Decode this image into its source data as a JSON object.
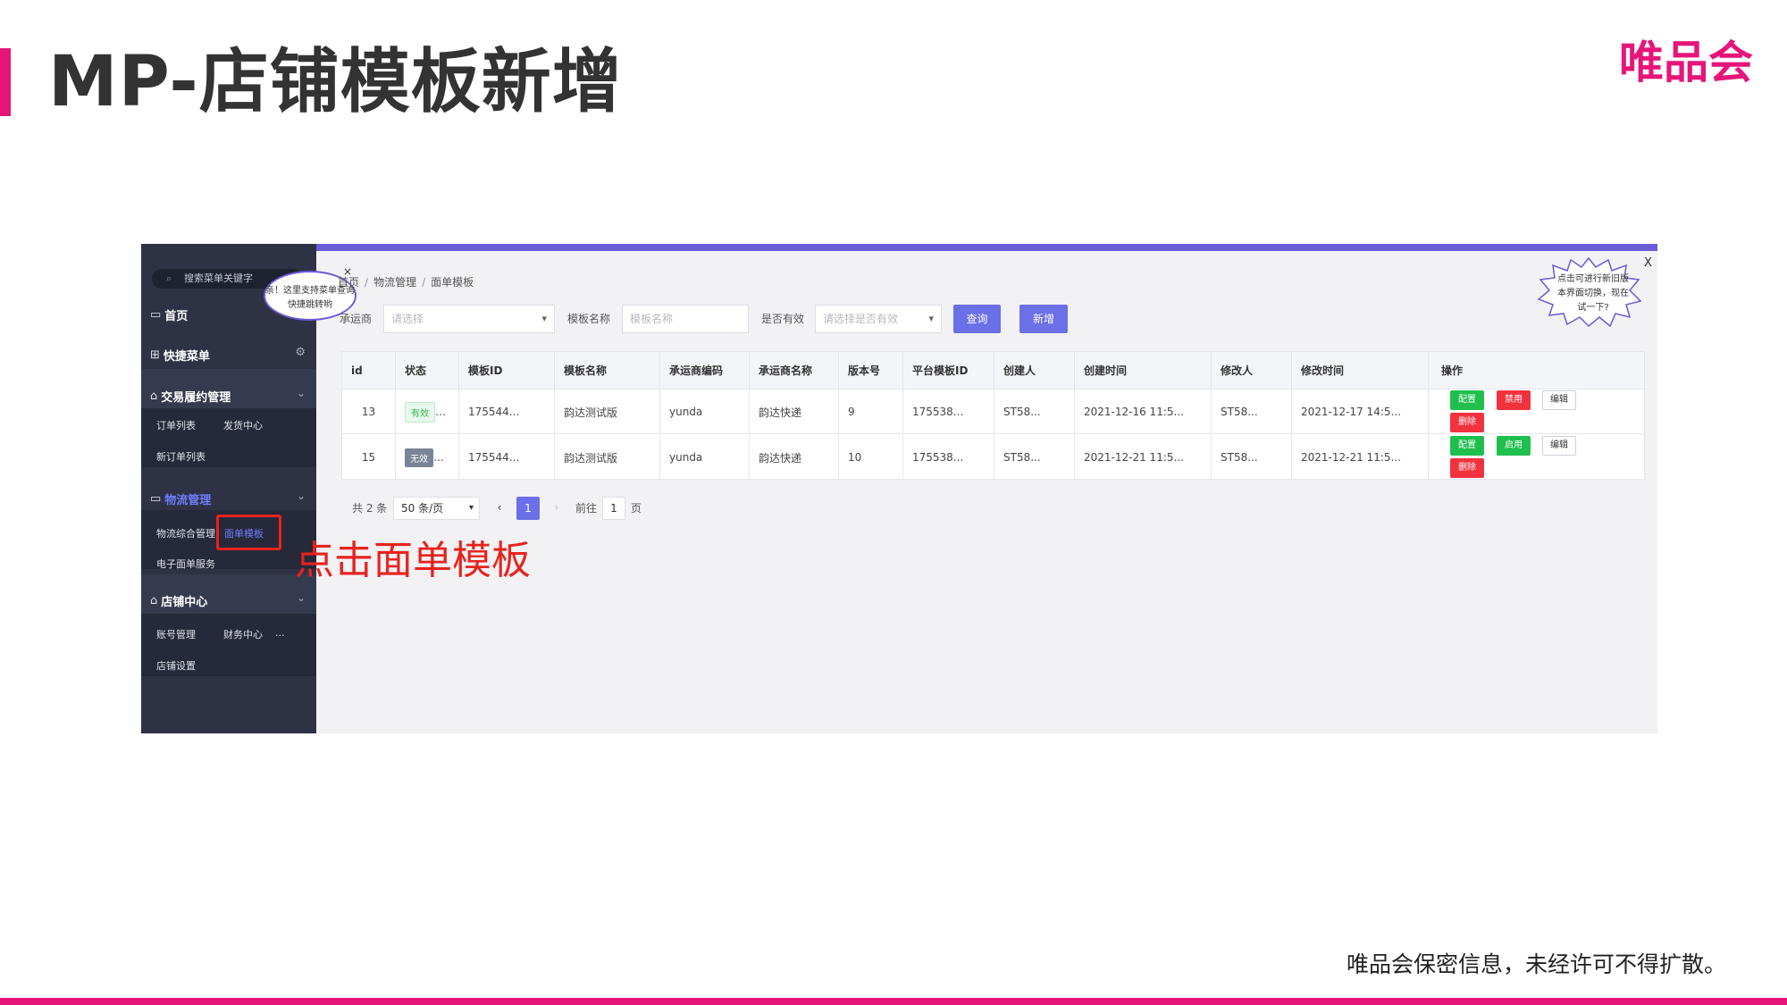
{
  "slide": {
    "title": "MP-店铺模板新增",
    "brand": "唯品会",
    "confidential": "唯品会保密信息，未经许可不得扩散。"
  },
  "annotation": "点击面单模板",
  "colors": {
    "accent": "#e6157a",
    "primary": "#6b6fe8",
    "annotation": "#e8231e"
  },
  "sidebar": {
    "search_placeholder": "搜索菜单关键字",
    "bubble": "亲！这里支持菜单查询快捷跳转哟",
    "home": "首页",
    "shortcut": "快捷菜单",
    "groups": [
      {
        "label": "交易履约管理",
        "subs": [
          "订单列表",
          "发货中心",
          "新订单列表"
        ]
      },
      {
        "label": "物流管理",
        "subs": [
          "物流综合管理",
          "面单模板",
          "电子面单服务"
        ]
      },
      {
        "label": "店铺中心",
        "subs": [
          "账号管理",
          "财务中心",
          "...",
          "店铺设置"
        ]
      }
    ]
  },
  "breadcrumb": [
    "首页",
    "物流管理",
    "面单模板"
  ],
  "filters": {
    "carrier_label": "承运商",
    "carrier_placeholder": "请选择",
    "template_name_label": "模板名称",
    "template_name_placeholder": "模板名称",
    "valid_label": "是否有效",
    "valid_placeholder": "请选择是否有效",
    "query_button": "查询",
    "add_button": "新增"
  },
  "hint": {
    "text": "点击可进行新旧版本界面切换，现在试一下?",
    "close": "X"
  },
  "table": {
    "headers": [
      "id",
      "状态",
      "模板ID",
      "模板名称",
      "承运商编码",
      "承运商名称",
      "版本号",
      "平台模板ID",
      "创建人",
      "创建时间",
      "修改人",
      "修改时间",
      "操作"
    ],
    "rows": [
      {
        "id": "13",
        "status": "有效",
        "template_id": "175544...",
        "template_name": "韵达测试版",
        "carrier_code": "yunda",
        "carrier_name": "韵达快递",
        "version": "9",
        "platform_template_id": "175538...",
        "creator": "ST58...",
        "created": "2021-12-16 11:5...",
        "modifier": "ST58...",
        "modified": "2021-12-17 14:5...",
        "ops": [
          "配置",
          "禁用",
          "编辑",
          "删除"
        ]
      },
      {
        "id": "15",
        "status": "无效",
        "template_id": "175544...",
        "template_name": "韵达测试版",
        "carrier_code": "yunda",
        "carrier_name": "韵达快递",
        "version": "10",
        "platform_template_id": "175538...",
        "creator": "ST58...",
        "created": "2021-12-21 11:5...",
        "modifier": "ST58...",
        "modified": "2021-12-21 11:5...",
        "ops": [
          "配置",
          "启用",
          "编辑",
          "删除"
        ]
      }
    ]
  },
  "pagination": {
    "total": "共 2 条",
    "page_size": "50 条/页",
    "current": "1",
    "goto_label": "前往",
    "goto_value": "1",
    "page_suffix": "页"
  }
}
